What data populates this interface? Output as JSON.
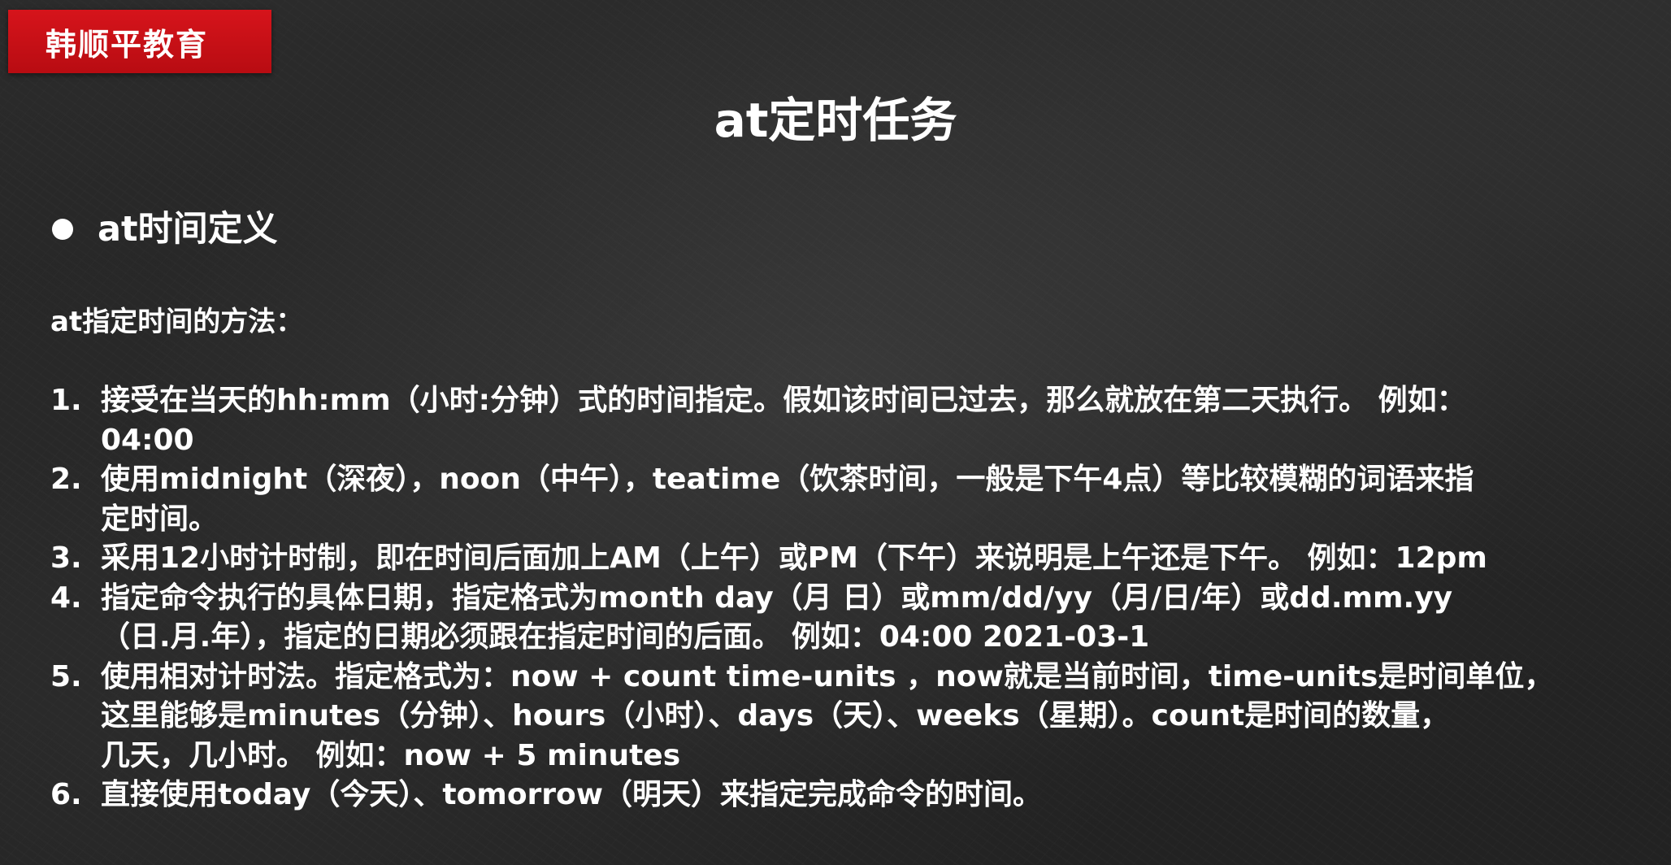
{
  "logo": {
    "text": "韩顺平教育",
    "color": "#d6141b"
  },
  "slide": {
    "title": "at定时任务",
    "section_title": "at时间定义",
    "intro": "at指定时间的方法：",
    "methods": [
      {
        "number": "1.",
        "lines": [
          "接受在当天的hh:mm（小时:分钟）式的时间指定。假如该时间已过去，那么就放在第二天执行。 例如：",
          "04:00"
        ]
      },
      {
        "number": "2.",
        "lines": [
          "使用midnight（深夜），noon（中午），teatime（饮茶时间，一般是下午4点）等比较模糊的词语来指",
          "定时间。"
        ]
      },
      {
        "number": "3.",
        "lines": [
          "采用12小时计时制，即在时间后面加上AM（上午）或PM（下午）来说明是上午还是下午。 例如：12pm"
        ]
      },
      {
        "number": "4.",
        "lines": [
          "指定命令执行的具体日期，指定格式为month day（月 日）或mm/dd/yy（月/日/年）或dd.mm.yy",
          "（日.月.年），指定的日期必须跟在指定时间的后面。 例如：04:00 2021-03-1"
        ]
      },
      {
        "number": "5.",
        "lines": [
          "使用相对计时法。指定格式为：now + count time-units ，now就是当前时间，time-units是时间单位，",
          "这里能够是minutes（分钟）、hours（小时）、days（天）、weeks（星期）。count是时间的数量，",
          "几天，几小时。 例如：now + 5 minutes"
        ]
      },
      {
        "number": "6.",
        "lines": [
          "直接使用today（今天）、tomorrow（明天）来指定完成命令的时间。"
        ]
      }
    ]
  }
}
